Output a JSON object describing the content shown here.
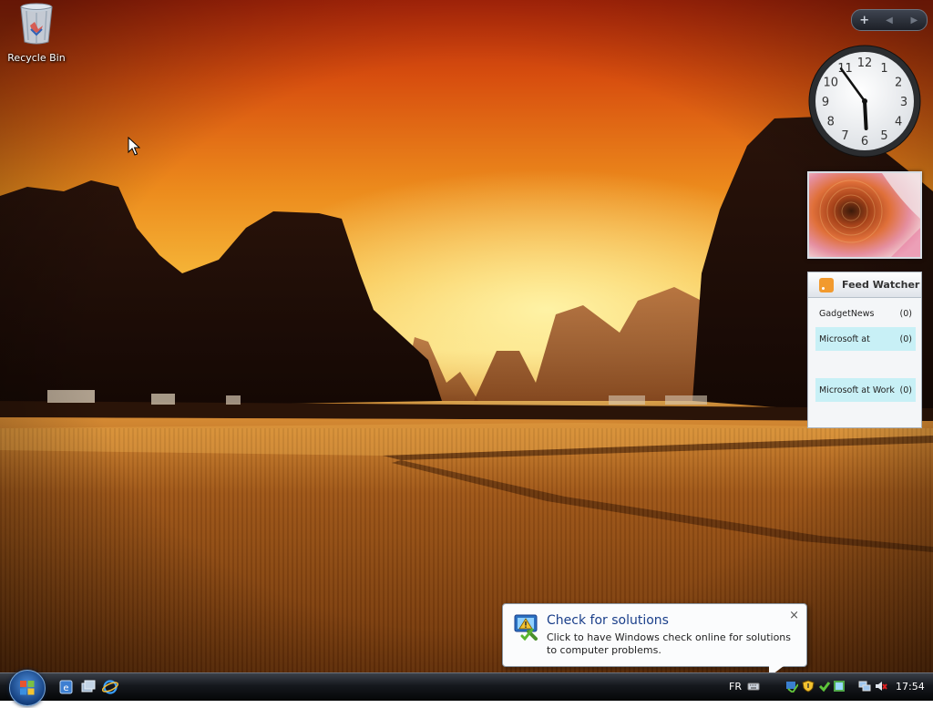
{
  "desktop": {
    "icons": [
      {
        "label": "Recycle Bin",
        "icon": "recycle-bin-icon"
      }
    ]
  },
  "sidebar": {
    "controls": {
      "add": "+",
      "prev": "◀",
      "next": "▶"
    },
    "clock": {
      "numbers": [
        "12",
        "1",
        "2",
        "3",
        "4",
        "5",
        "6",
        "7",
        "8",
        "9",
        "10",
        "11"
      ],
      "hour": 5,
      "minute": 54
    },
    "feed_watcher": {
      "title": "Feed Watcher",
      "feeds": [
        {
          "name": "GadgetNews",
          "count": "(0)",
          "highlight": false
        },
        {
          "name": "Microsoft at",
          "count": "(0)",
          "highlight": true
        },
        {
          "name": "Microsoft at Work",
          "count": "(0)",
          "highlight": true
        }
      ]
    }
  },
  "notification": {
    "title": "Check for solutions",
    "text": "Click to have Windows check online for solutions to computer problems.",
    "close": "×"
  },
  "taskbar": {
    "language": "FR",
    "time": "17:54"
  },
  "colors": {
    "accent_blue": "#1a3f8a",
    "feed_highlight": "#c8f0f6"
  }
}
